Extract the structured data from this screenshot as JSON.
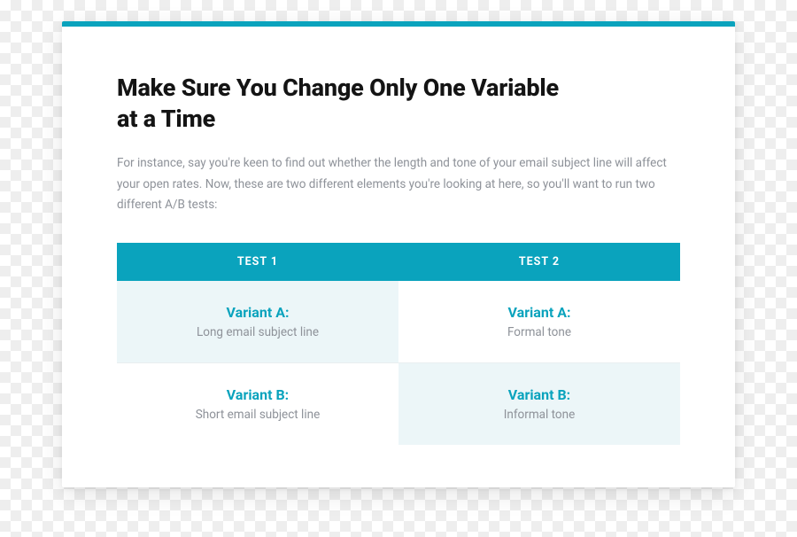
{
  "title": "Make Sure You Change Only One Variable at a Time",
  "body": "For instance, say you're keen to find out whether the length and tone of your email subject line will affect your open rates. Now, these are two different elements you're looking at here, so you'll want to run two different A/B tests:",
  "table": {
    "headers": {
      "col1": "TEST 1",
      "col2": "TEST 2"
    },
    "rows": [
      {
        "col1": {
          "label": "Variant A:",
          "desc": "Long email subject line"
        },
        "col2": {
          "label": "Variant A:",
          "desc": "Formal tone"
        }
      },
      {
        "col1": {
          "label": "Variant B:",
          "desc": "Short email subject line"
        },
        "col2": {
          "label": "Variant B:",
          "desc": "Informal tone"
        }
      }
    ]
  }
}
